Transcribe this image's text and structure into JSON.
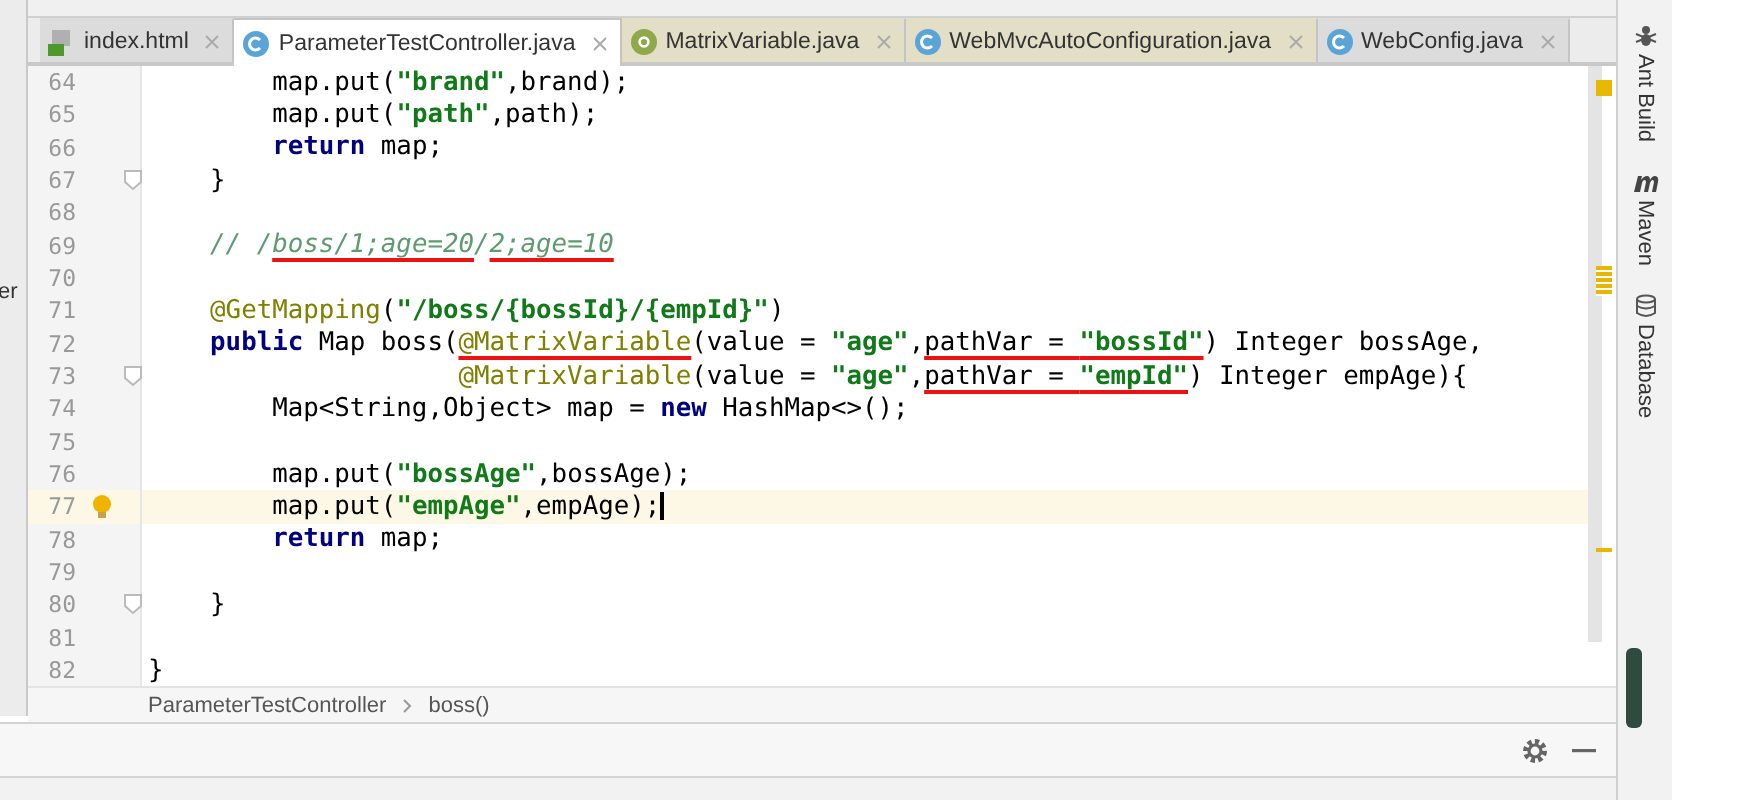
{
  "tabs": [
    {
      "label": "index.html",
      "kind": "html",
      "selected": false,
      "color": "#dcdcdc"
    },
    {
      "label": "ParameterTestController.java",
      "kind": "class",
      "selected": true,
      "color": "#ffffff"
    },
    {
      "label": "MatrixVariable.java",
      "kind": "annotation",
      "selected": false,
      "color": "#e3dfc6"
    },
    {
      "label": "WebMvcAutoConfiguration.java",
      "kind": "class",
      "selected": false,
      "color": "#e3dfc6"
    },
    {
      "label": "WebConfig.java",
      "kind": "class",
      "selected": false,
      "color": "#dcdcdc"
    }
  ],
  "left_strip": {
    "label": "er"
  },
  "code_lines": [
    {
      "number": "64",
      "fold": false,
      "current": false,
      "segments": [
        {
          "text": "        map.put(",
          "kind": "plain"
        },
        {
          "text": "\"brand\"",
          "kind": "string"
        },
        {
          "text": ",brand);",
          "kind": "plain"
        }
      ]
    },
    {
      "number": "65",
      "fold": false,
      "current": false,
      "segments": [
        {
          "text": "        map.put(",
          "kind": "plain"
        },
        {
          "text": "\"path\"",
          "kind": "string"
        },
        {
          "text": ",path);",
          "kind": "plain"
        }
      ]
    },
    {
      "number": "66",
      "fold": false,
      "current": false,
      "segments": [
        {
          "text": "        return",
          "kind": "keyword"
        },
        {
          "text": " map;",
          "kind": "plain"
        }
      ]
    },
    {
      "number": "67",
      "fold": true,
      "current": false,
      "segments": [
        {
          "text": "    }",
          "kind": "plain"
        }
      ]
    },
    {
      "number": "68",
      "fold": false,
      "current": false
    },
    {
      "number": "69",
      "fold": false,
      "current": false,
      "segments": [
        {
          "text": "    // /",
          "kind": "comment"
        },
        {
          "text": "boss/1;age=20",
          "kind": "comment",
          "underlined": true
        },
        {
          "text": "/",
          "kind": "comment"
        },
        {
          "text": "2;age=10",
          "kind": "comment",
          "underlined": true
        }
      ]
    },
    {
      "number": "70",
      "fold": false,
      "current": false
    },
    {
      "number": "71",
      "fold": false,
      "current": false,
      "segments": [
        {
          "text": "    @GetMapping",
          "kind": "annotation"
        },
        {
          "text": "(",
          "kind": "plain"
        },
        {
          "text": "\"/boss/{bossId}/{empId}\"",
          "kind": "string"
        },
        {
          "text": ")",
          "kind": "plain"
        }
      ]
    },
    {
      "number": "72",
      "fold": false,
      "current": false,
      "segments": [
        {
          "text": "    public",
          "kind": "keyword"
        },
        {
          "text": " Map boss(",
          "kind": "plain"
        },
        {
          "text": "@MatrixVariable",
          "kind": "annotation",
          "underlined": true
        },
        {
          "text": "(value = ",
          "kind": "plain"
        },
        {
          "text": "\"age\"",
          "kind": "string"
        },
        {
          "text": ",",
          "kind": "plain"
        },
        {
          "text": "pathVar = ",
          "kind": "plain",
          "underlined": true
        },
        {
          "text": "\"bossId\"",
          "kind": "string",
          "underlined": true
        },
        {
          "text": ") Integer bossAge,",
          "kind": "plain"
        }
      ]
    },
    {
      "number": "73",
      "fold": true,
      "current": false,
      "segments": [
        {
          "text": "                    @MatrixVariable",
          "kind": "annotation"
        },
        {
          "text": "(value = ",
          "kind": "plain"
        },
        {
          "text": "\"age\"",
          "kind": "string"
        },
        {
          "text": ",",
          "kind": "plain"
        },
        {
          "text": "pathVar = ",
          "kind": "plain",
          "underlined": true
        },
        {
          "text": "\"empId\"",
          "kind": "string",
          "underlined": true
        },
        {
          "text": ") Integer empAge){",
          "kind": "plain"
        }
      ]
    },
    {
      "number": "74",
      "fold": false,
      "current": false,
      "segments": [
        {
          "text": "        Map<String,Object> map = ",
          "kind": "plain"
        },
        {
          "text": "new",
          "kind": "keyword"
        },
        {
          "text": " HashMap<>();",
          "kind": "plain"
        }
      ]
    },
    {
      "number": "75",
      "fold": false,
      "current": false
    },
    {
      "number": "76",
      "fold": false,
      "current": false,
      "segments": [
        {
          "text": "        map.put(",
          "kind": "plain"
        },
        {
          "text": "\"bossAge\"",
          "kind": "string"
        },
        {
          "text": ",bossAge);",
          "kind": "plain"
        }
      ]
    },
    {
      "number": "77",
      "fold": false,
      "current": true,
      "segments": [
        {
          "text": "        map.put(",
          "kind": "plain"
        },
        {
          "text": "\"empAge\"",
          "kind": "string"
        },
        {
          "text": ",empAge);",
          "kind": "plain"
        }
      ]
    },
    {
      "number": "78",
      "fold": false,
      "current": false,
      "segments": [
        {
          "text": "        return",
          "kind": "keyword"
        },
        {
          "text": " map;",
          "kind": "plain"
        }
      ]
    },
    {
      "number": "79",
      "fold": false,
      "current": false
    },
    {
      "number": "80",
      "fold": true,
      "current": false,
      "segments": [
        {
          "text": "    }",
          "kind": "plain"
        }
      ]
    },
    {
      "number": "81",
      "fold": false,
      "current": false
    },
    {
      "number": "82",
      "fold": false,
      "current": false,
      "segments": [
        {
          "text": "}",
          "kind": "plain"
        }
      ]
    }
  ],
  "breadcrumb": [
    "ParameterTestController",
    "boss()"
  ],
  "tool_windows": [
    {
      "label": "Ant Build",
      "kind": "ant"
    },
    {
      "label": "Maven",
      "kind": "maven"
    },
    {
      "label": "Database",
      "kind": "database"
    }
  ]
}
